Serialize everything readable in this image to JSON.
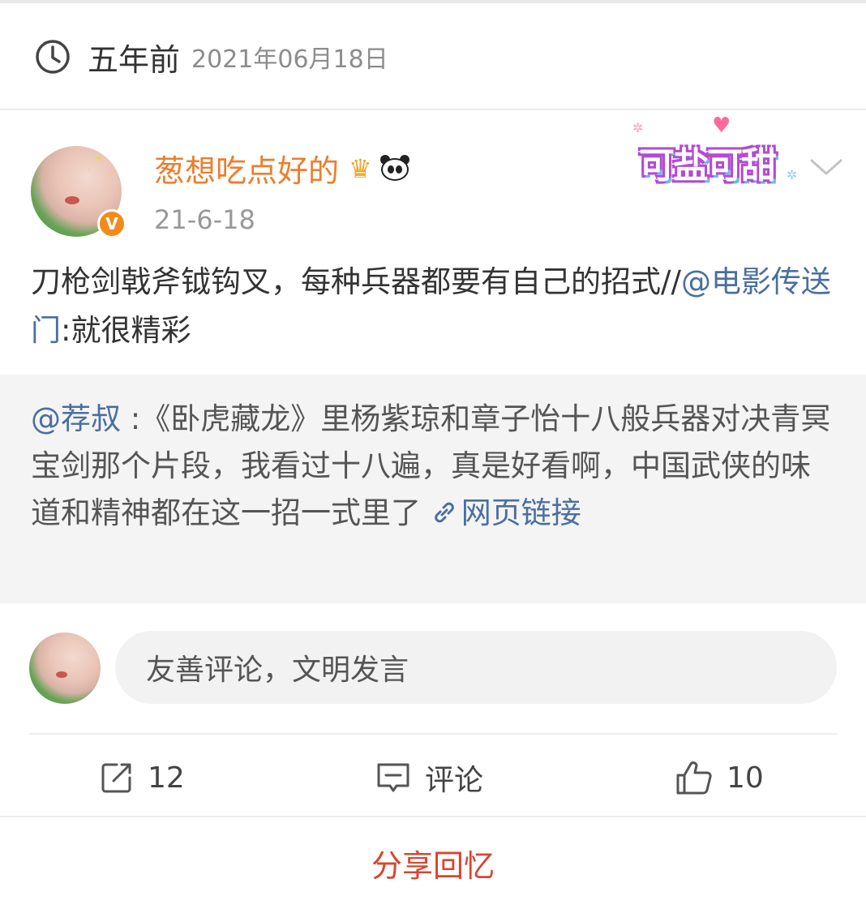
{
  "header": {
    "relative_time": "五年前",
    "date": "2021年06月18日",
    "icon": "clock-icon"
  },
  "post": {
    "username": "葱想吃点好的",
    "verified_badge": "V",
    "time": "21-6-18",
    "badge_icons": [
      "crown-icon",
      "panda-icon"
    ],
    "sticker_text": "可盐可甜",
    "body_prefix": "刀枪剑戟斧钺钩叉，每种兵器都要有自己的招式//",
    "body_mention": "@电影传送门",
    "body_suffix": ":就很精彩"
  },
  "repost": {
    "author": "@荐叔",
    "separator": " :",
    "text": "《卧虎藏龙》里杨紫琼和章子怡十八般兵器对决青冥宝剑那个片段，我看过十八遍，真是好看啊，中国武侠的味道和精神都在这一招一式里了",
    "link_label": "网页链接"
  },
  "comment": {
    "placeholder": "友善评论，文明发言"
  },
  "actions": {
    "share_count": "12",
    "comment_label": "评论",
    "like_count": "10"
  },
  "footer": {
    "share_memory_label": "分享回忆"
  },
  "colors": {
    "username": "#ee7d2d",
    "mention": "#4a6fa0",
    "footer_action": "#d9452f",
    "verified_badge": "#f38b1a"
  }
}
